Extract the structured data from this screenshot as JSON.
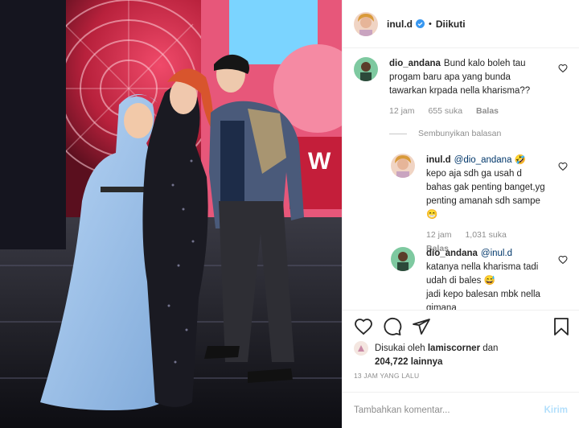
{
  "post": {
    "author": "inul.d",
    "dot": "•",
    "follow_label": "Diikuti"
  },
  "comments": [
    {
      "username": "dio_andana",
      "text": "Bund kalo boleh tau progam baru apa yang bunda tawarkan krpada nella kharisma??",
      "time": "12 jam",
      "likes": "655 suka",
      "reply_label": "Balas"
    }
  ],
  "hide_replies_label": "Sembunyikan balasan",
  "replies": [
    {
      "username": "inul.d",
      "mention": "@dio_andana",
      "emoji1": "🤣",
      "text": "kepo aja sdh ga usah d bahas gak penting banget,yg penting amanah sdh sampe",
      "emoji2": "😁",
      "time": "12 jam",
      "likes": "1,031 suka",
      "reply_label": "Balas"
    },
    {
      "username": "dio_andana",
      "mention": "@inul.d",
      "text": "katanya nella kharisma tadi udah di bales",
      "emoji1": "😅",
      "text2": "jadi kepo balesan mbk nella gimana"
    }
  ],
  "likes_line": {
    "prefix": "Disukai oleh",
    "user": "lamiscorner",
    "joiner": "dan",
    "count": "204,722 lainnya"
  },
  "timestamp": "13 JAM YANG LALU",
  "composer": {
    "placeholder": "Tambahkan komentar...",
    "post_label": "Kirim"
  },
  "colors": {
    "verified": "#3897f0",
    "link": "#00376b",
    "muted": "#8e8e8e",
    "post_disabled": "#b2dffc"
  },
  "icons": [
    "verified-badge-icon",
    "heart-icon",
    "comment-icon",
    "share-icon",
    "bookmark-icon"
  ]
}
